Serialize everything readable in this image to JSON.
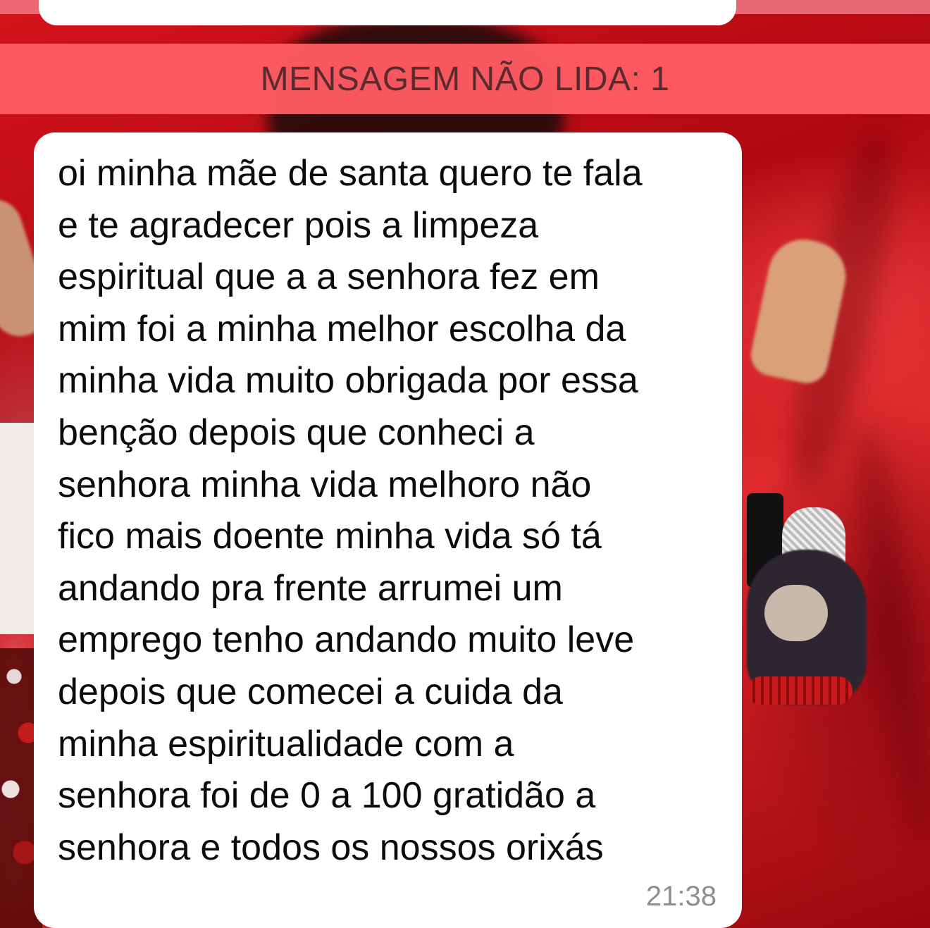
{
  "colors": {
    "wallpaper": "#b00a12",
    "unread_bar": "#ff5c64",
    "unread_text": "#5a2a2e",
    "bubble": "#ffffff",
    "message_text": "#0b0b0b",
    "timestamp_text": "#8e8e8e"
  },
  "chat": {
    "unread_divider": "MENSAGEM NÃO LIDA: 1",
    "message": {
      "text": "oi minha mãe de santa quero te fala\ne te agradecer pois a limpeza\nespiritual que a a senhora fez em\nmim foi a minha melhor escolha da\nminha vida muito obrigada por essa\nbenção depois que conheci a\nsenhora minha vida melhoro não\nfico mais doente minha vida só tá\nandando pra frente arrumei um\nemprego tenho andando muito leve\ndepois que comecei a cuida da\nminha espiritualidade com a\nsenhora foi de 0 a 100 gratidão a\nsenhora e todos os nossos orixás",
      "time": "21:38"
    }
  }
}
